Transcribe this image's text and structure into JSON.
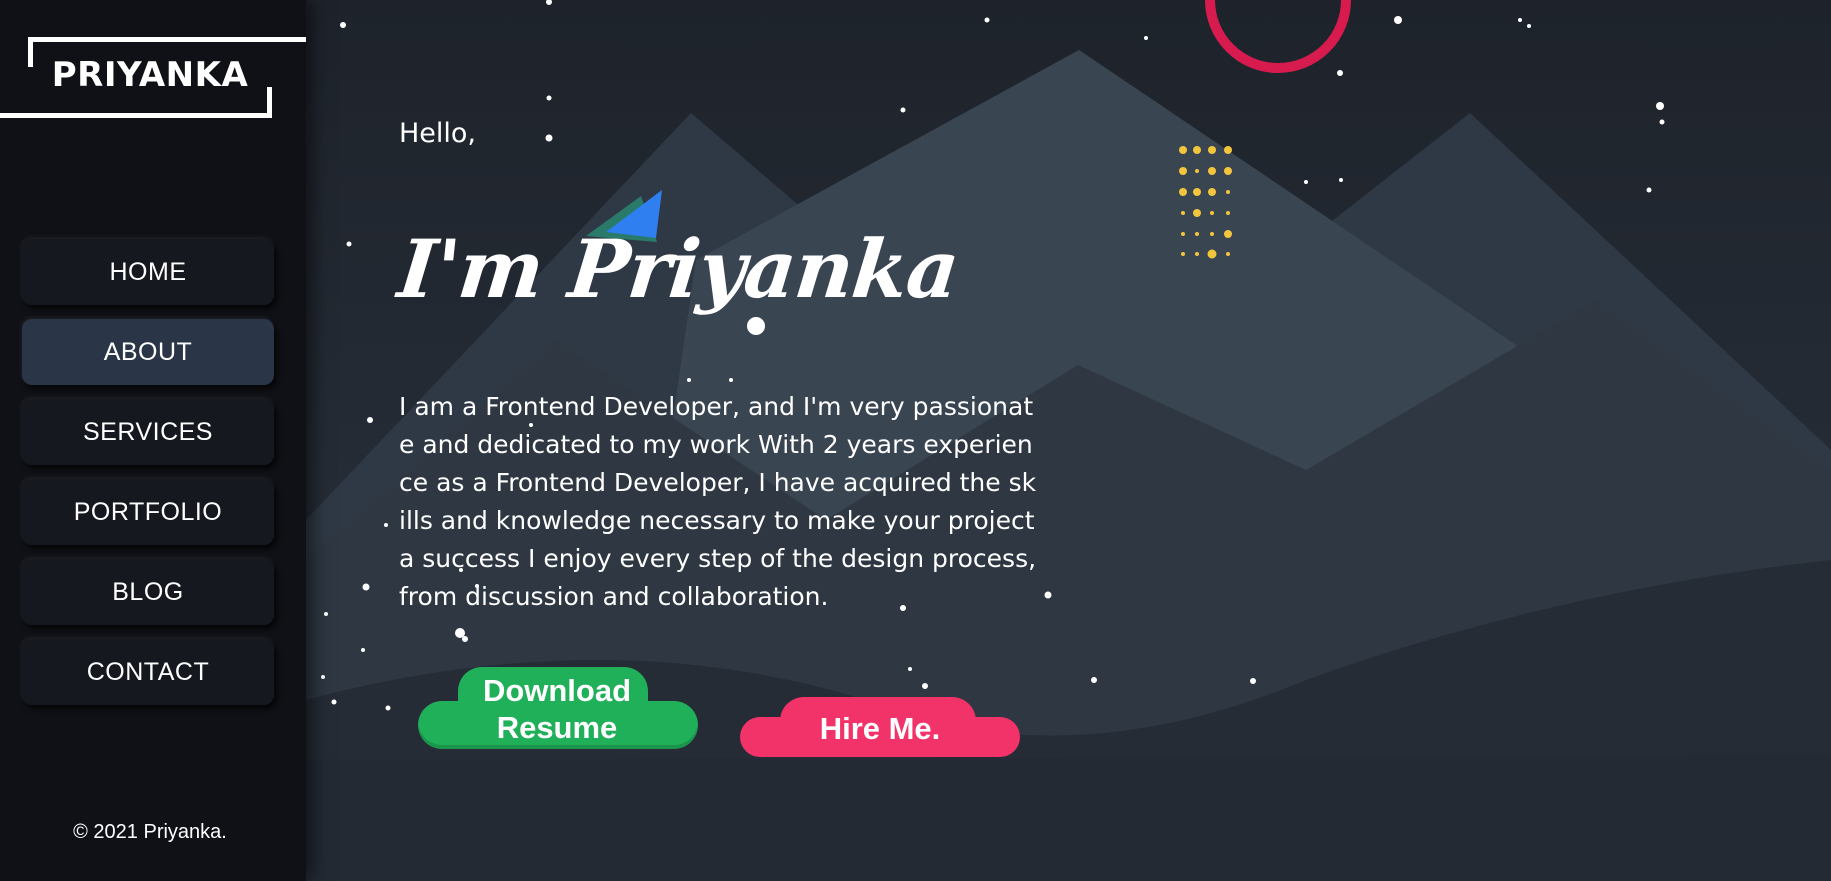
{
  "sidebar": {
    "logo": "PRIYANKA",
    "nav": [
      {
        "label": "HOME",
        "active": false
      },
      {
        "label": "ABOUT",
        "active": true
      },
      {
        "label": "SERVICES",
        "active": false
      },
      {
        "label": "PORTFOLIO",
        "active": false
      },
      {
        "label": "BLOG",
        "active": false
      },
      {
        "label": "CONTACT",
        "active": false
      }
    ],
    "copyright": "© 2021 Priyanka."
  },
  "hero": {
    "greeting": "Hello,",
    "title": "I'm Priyanka",
    "description": "I am a Frontend Developer, and I'm very passionate and dedicated to my work With 2 years experience as a Frontend Developer, I have acquired the skills and knowledge necessary to make your project a success I enjoy every step of the design process, from discussion and collaboration.",
    "download_button": "Download Resume",
    "hire_button": "Hire Me."
  },
  "colors": {
    "sidebar_bg": "#0f1116",
    "active_nav": "#2a3548",
    "accent_green": "#21b05a",
    "accent_pink": "#f2336a",
    "ring_red": "#d81b4f",
    "dots_yellow": "#f2c53d",
    "triangle_blue": "#2f7ff0"
  }
}
